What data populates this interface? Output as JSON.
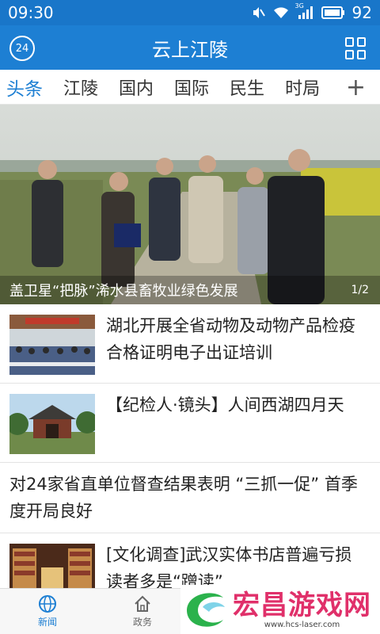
{
  "status": {
    "time": "09:30",
    "battery": "92",
    "network": "3G"
  },
  "appbar": {
    "logo": "24",
    "title": "云上江陵"
  },
  "tabs": [
    {
      "label": "头条",
      "active": true
    },
    {
      "label": "江陵"
    },
    {
      "label": "国内"
    },
    {
      "label": "国际"
    },
    {
      "label": "民生"
    },
    {
      "label": "时局"
    }
  ],
  "tab_add": "+",
  "hero": {
    "caption": "盖卫星“把脉”浠水县畜牧业绿色发展",
    "pager": "1/2"
  },
  "news": [
    {
      "title": "湖北开展全省动物及动物产品检疫合格证明电子出证培训",
      "thumb": "meeting-room"
    },
    {
      "title": "【纪检人·镜头】人间西湖四月天",
      "thumb": "temple"
    },
    {
      "title": "对24家省直单位督查结果表明 “三抓一促” 首季度开局良好"
    },
    {
      "title": "[文化调查]武汉实体书店普遍亏损 读者多是“蹭读”",
      "thumb": "bookstore"
    }
  ],
  "bottomnav": [
    {
      "label": "新闻",
      "icon": "globe-icon",
      "active": true
    },
    {
      "label": "政务",
      "icon": "home-icon"
    }
  ],
  "watermark": {
    "title": "宏昌游戏网",
    "url": "www.hcs-laser.com"
  },
  "colors": {
    "primary": "#1d7fd3",
    "statusbar": "#1976c9",
    "watermark": "#e0306a"
  }
}
